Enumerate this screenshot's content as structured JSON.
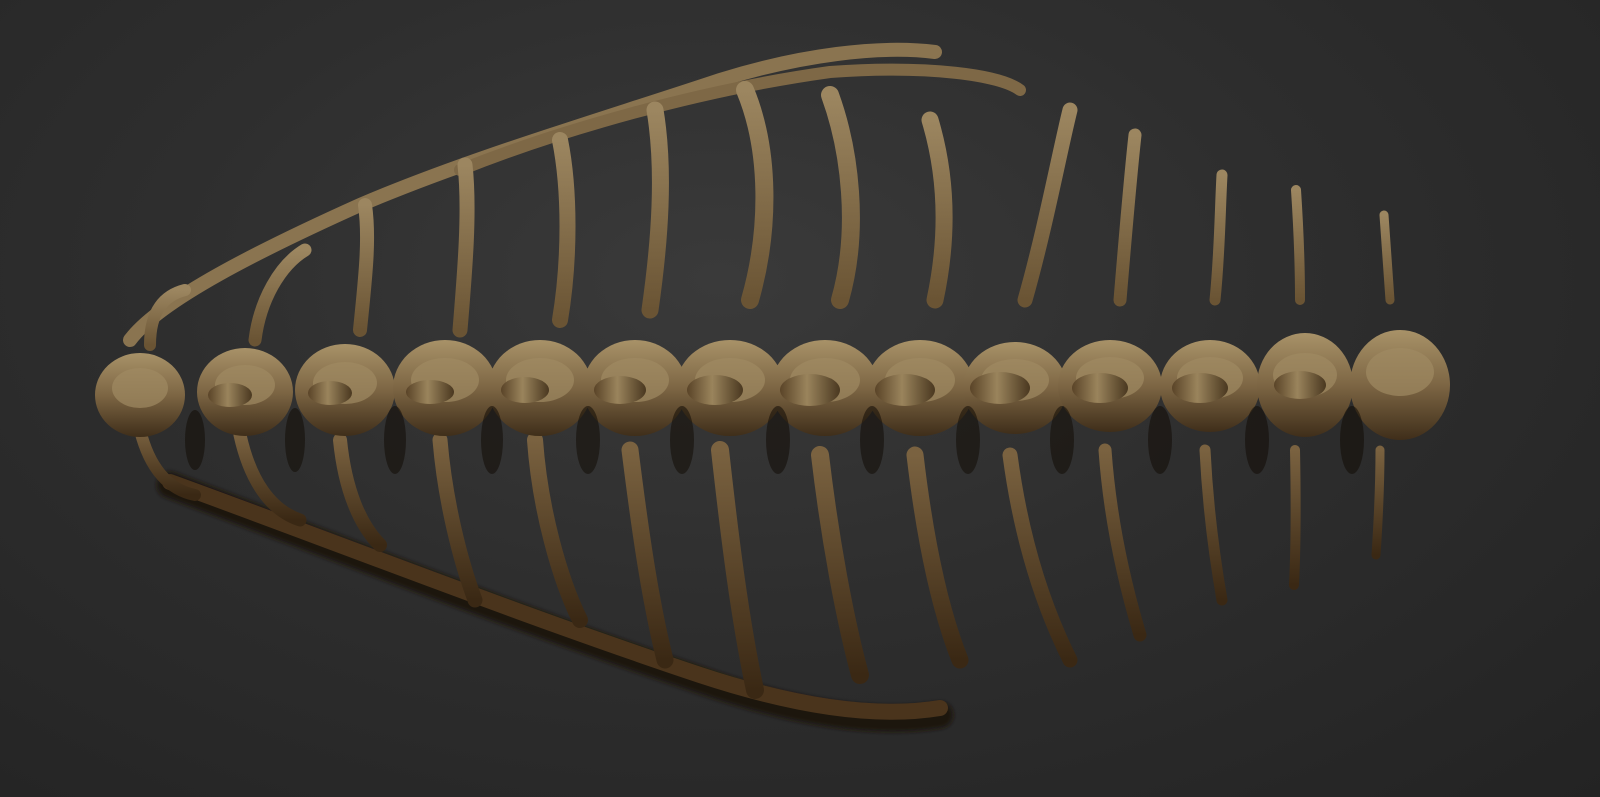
{
  "scene": {
    "subject": "vertebral-column-with-ribs",
    "vertebra_count": 14,
    "colors": {
      "background_center": "#3a3a3a",
      "background_edge": "#232323",
      "bone_light": "#a08a62",
      "bone_mid": "#7a6440",
      "bone_dark": "#3c2c18",
      "shadow": "#0e0a06"
    }
  }
}
